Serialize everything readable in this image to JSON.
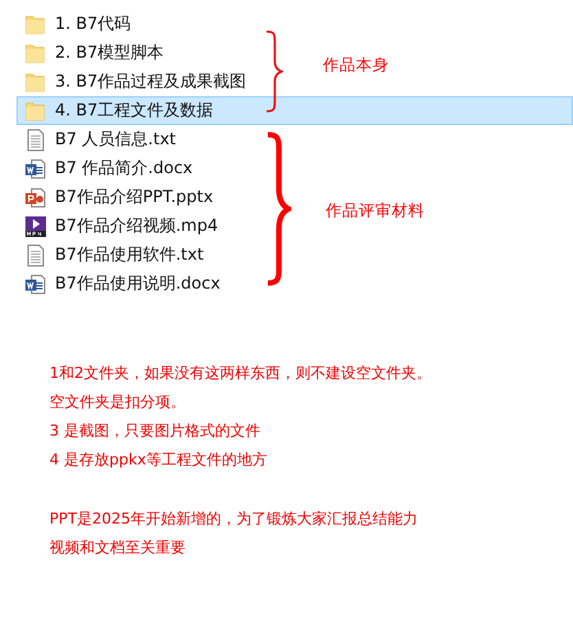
{
  "files": [
    {
      "kind": "folder",
      "name": "1. B7代码",
      "selected": false
    },
    {
      "kind": "folder",
      "name": "2. B7模型脚本",
      "selected": false
    },
    {
      "kind": "folder",
      "name": "3. B7作品过程及成果截图",
      "selected": false
    },
    {
      "kind": "folder",
      "name": "4. B7工程文件及数据",
      "selected": true
    },
    {
      "kind": "text",
      "name": "B7 人员信息.txt",
      "selected": false
    },
    {
      "kind": "word",
      "name": "B7 作品简介.docx",
      "selected": false
    },
    {
      "kind": "slides",
      "name": "B7作品介绍PPT.pptx",
      "selected": false
    },
    {
      "kind": "video",
      "name": "B7作品介绍视频.mp4",
      "selected": false
    },
    {
      "kind": "text",
      "name": "B7作品使用软件.txt",
      "selected": false
    },
    {
      "kind": "word",
      "name": "B7作品使用说明.docx",
      "selected": false
    }
  ],
  "annotations": [
    "作品本身",
    "作品评审材料"
  ],
  "notes": [
    [
      "1和2文件夹，如果没有这两样东西，则不建设空文件夹。",
      "空文件夹是扣分项。",
      "3 是截图，只要图片格式的文件",
      "4 是存放ppkx等工程文件的地方"
    ],
    [
      "PPT是2025年开始新增的，为了锻炼大家汇报总结能力",
      "视频和文档至关重要"
    ]
  ]
}
